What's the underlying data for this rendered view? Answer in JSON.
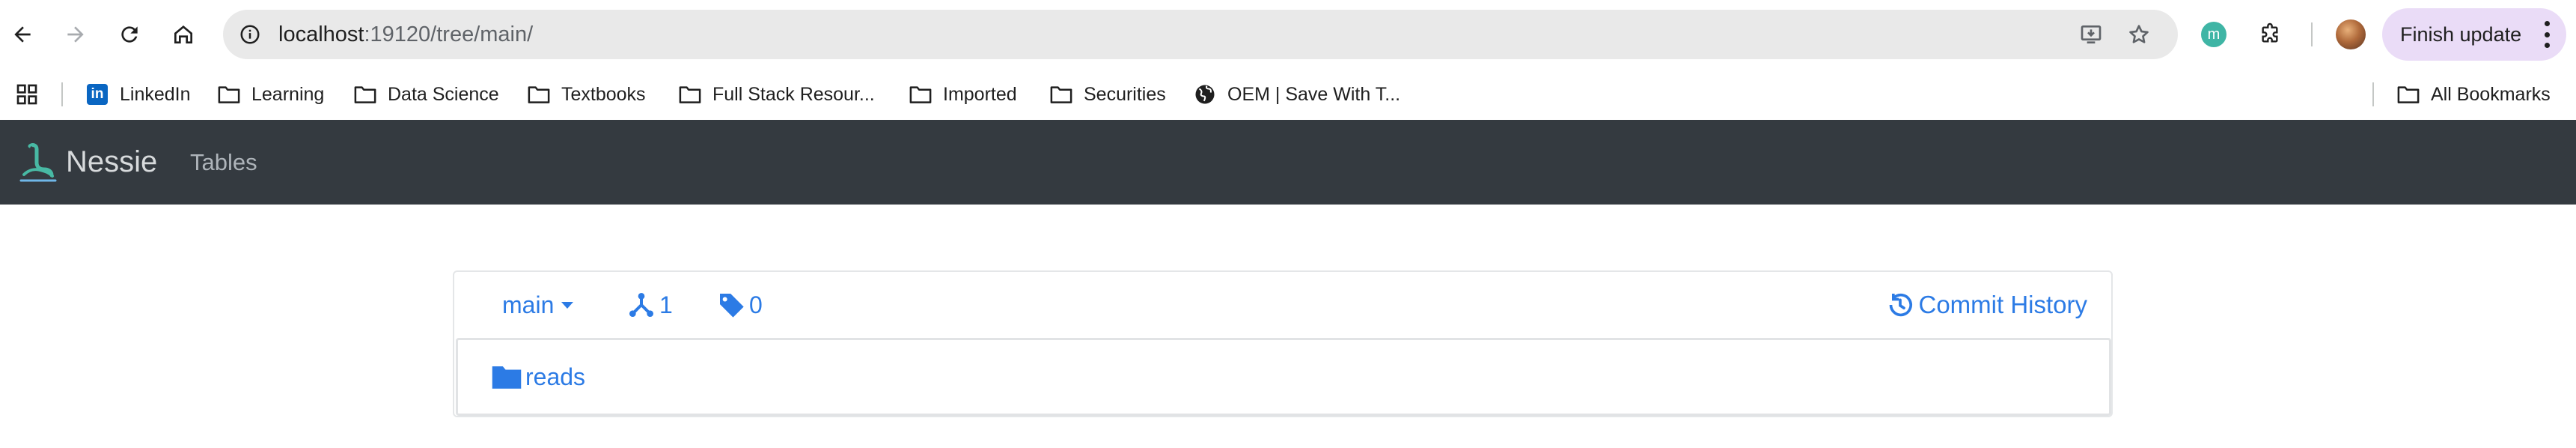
{
  "browser": {
    "url_host": "localhost",
    "url_rest": ":19120/tree/main/",
    "finish_update_label": "Finish update",
    "extension_badge": "m",
    "icons": [
      "back-icon",
      "forward-icon",
      "reload-icon",
      "home-icon",
      "site-info-icon",
      "install-app-icon",
      "bookmark-star-icon",
      "extensions-icon",
      "more-menu-icon"
    ]
  },
  "bookmarks": {
    "items": [
      {
        "label": "LinkedIn",
        "icon": "linkedin-icon"
      },
      {
        "label": "Learning",
        "icon": "folder-icon"
      },
      {
        "label": "Data Science",
        "icon": "folder-icon"
      },
      {
        "label": "Textbooks",
        "icon": "folder-icon"
      },
      {
        "label": "Full Stack Resour...",
        "icon": "folder-icon"
      },
      {
        "label": "Imported",
        "icon": "folder-icon"
      },
      {
        "label": "Securities",
        "icon": "folder-icon"
      },
      {
        "label": "OEM | Save With T...",
        "icon": "globe-icon"
      }
    ],
    "all_bookmarks": "All Bookmarks"
  },
  "app": {
    "brand": "Nessie",
    "nav_tables": "Tables",
    "colors": {
      "navbar": "#343a40",
      "link": "#2c7be5"
    }
  },
  "card": {
    "branch": "main",
    "branches_count": "1",
    "tags_count": "0",
    "commit_history": "Commit History",
    "entries": [
      {
        "name": "reads",
        "icon": "folder-icon"
      }
    ]
  }
}
